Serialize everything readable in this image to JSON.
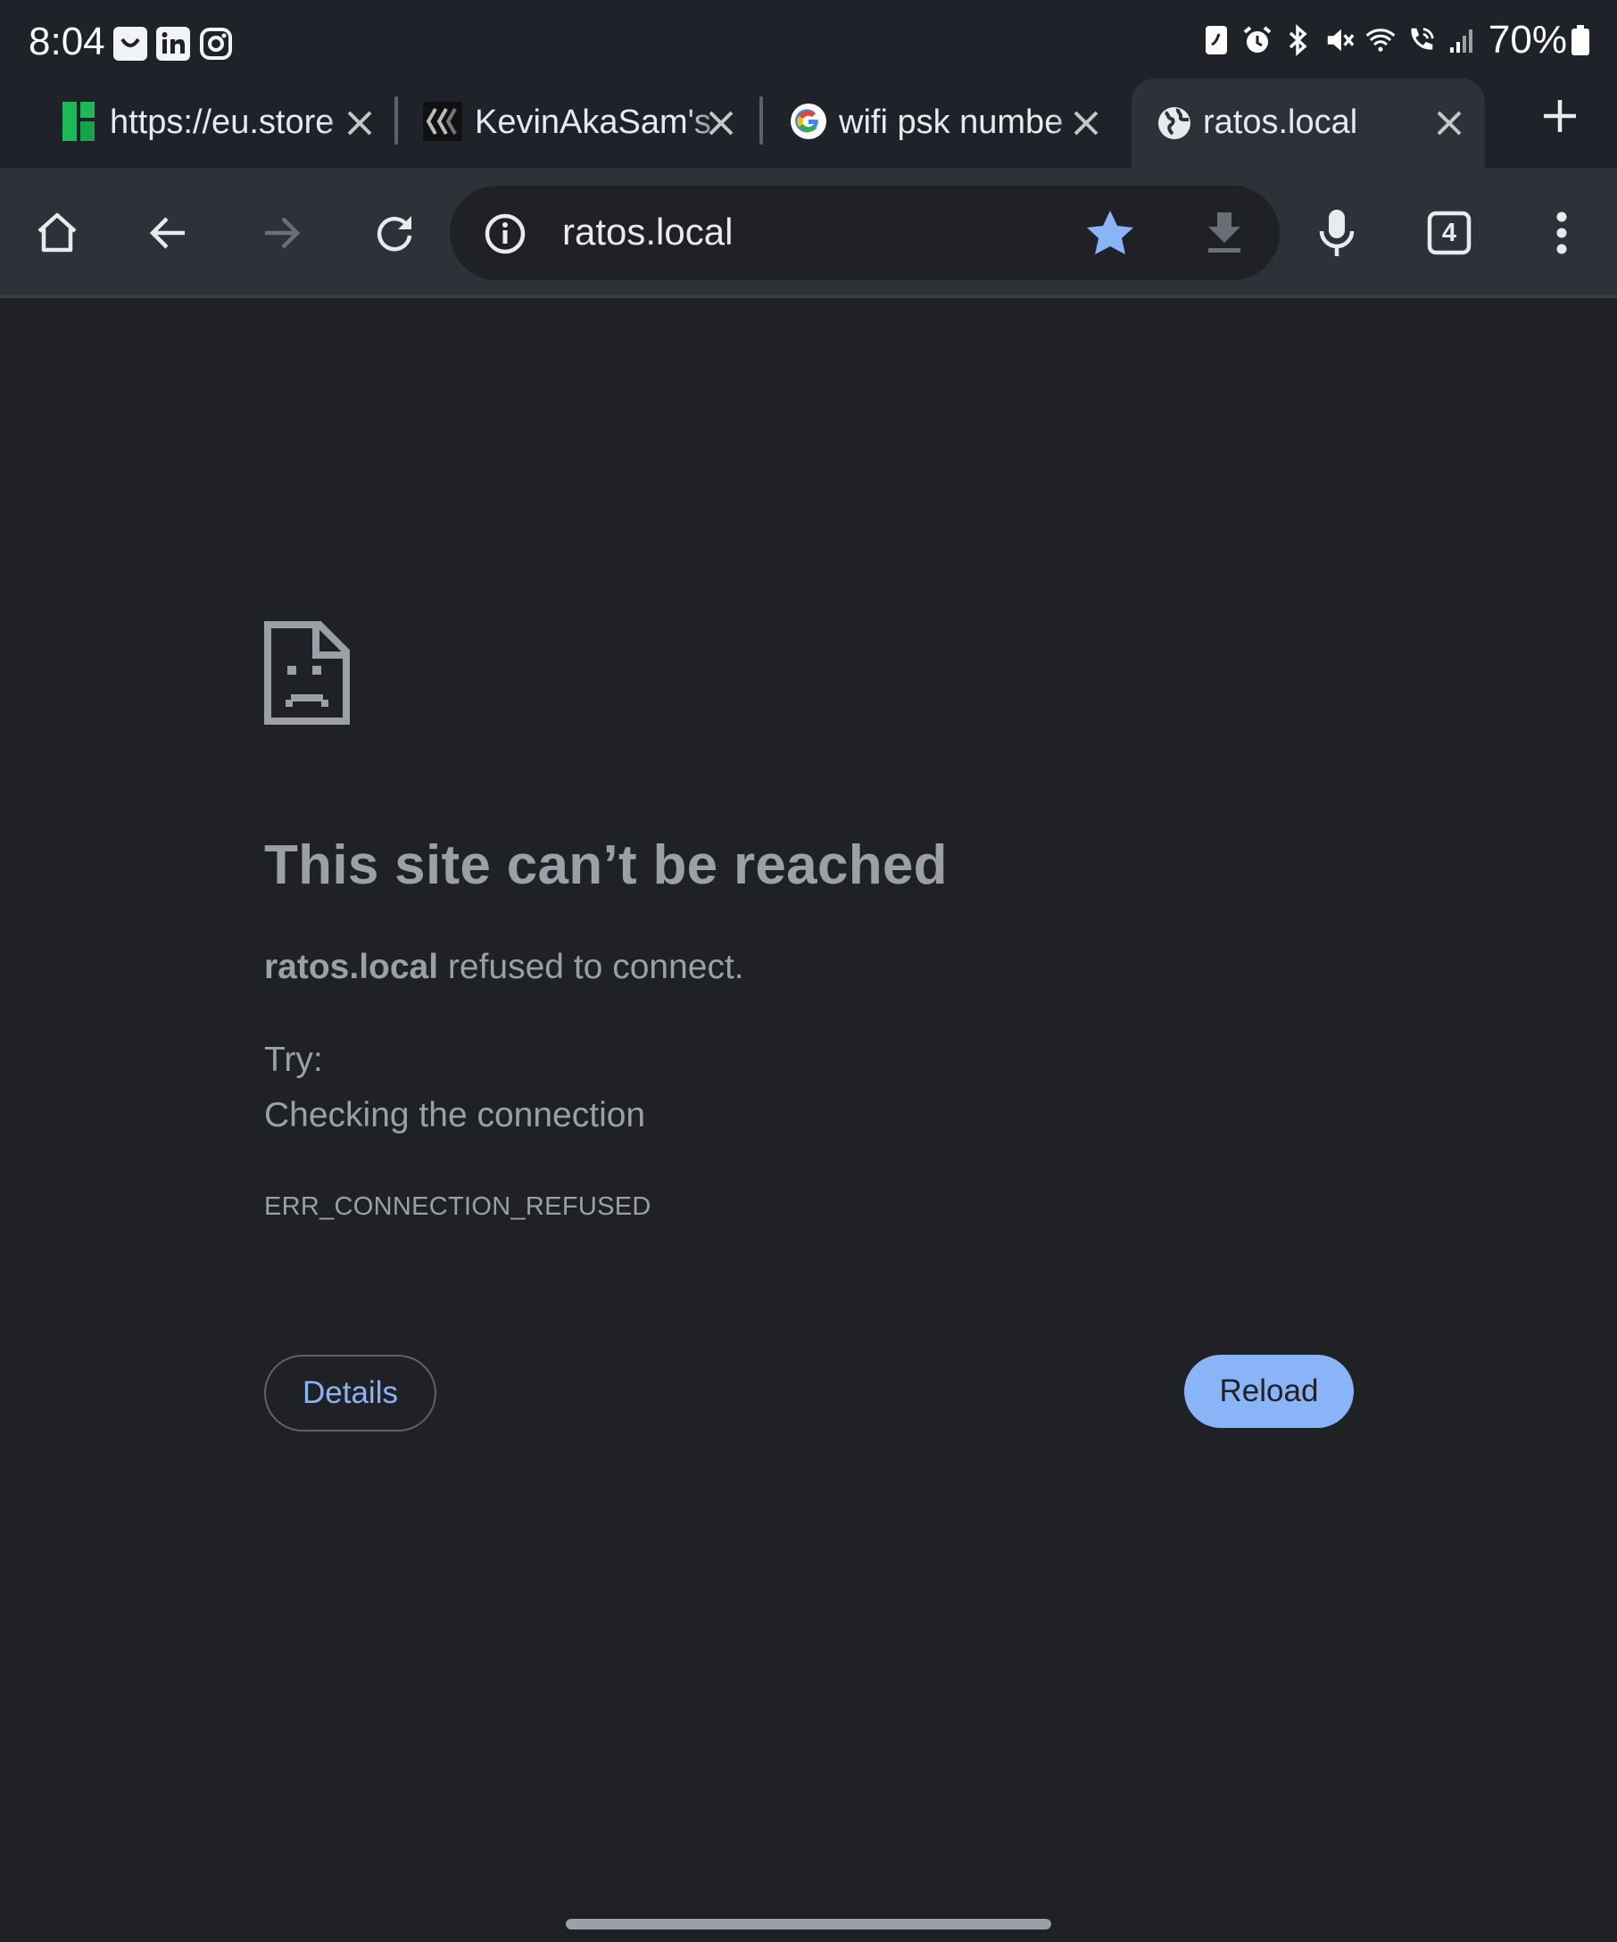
{
  "status_bar": {
    "time": "8:04",
    "battery": "70%",
    "notification_icons": [
      "smile-icon",
      "linkedin-icon",
      "instagram-icon"
    ],
    "system_icons": [
      "nfc-icon",
      "alarm-icon",
      "bluetooth-icon",
      "mute-icon",
      "wifi-icon",
      "wifi-calling-icon",
      "signal-icon",
      "battery-icon"
    ]
  },
  "tabs": [
    {
      "label": "https://eu.store",
      "favicon": "store-favicon-icon",
      "active": false
    },
    {
      "label": "KevinAkaSam's",
      "favicon": "k-favicon-icon",
      "active": false
    },
    {
      "label": "wifi psk numbe",
      "favicon": "google-favicon-icon",
      "active": false
    },
    {
      "label": "ratos.local",
      "favicon": "globe-icon",
      "active": true
    }
  ],
  "toolbar": {
    "url": "ratos.local",
    "tab_count": "4",
    "icons": [
      "home-icon",
      "back-icon",
      "forward-icon",
      "reload-icon",
      "info-icon",
      "star-icon",
      "download-icon",
      "mic-icon",
      "tab-switcher-icon",
      "more-icon"
    ]
  },
  "error": {
    "title": "This site can’t be reached",
    "host": "ratos.local",
    "description": " refused to connect.",
    "try_label": "Try:",
    "suggestion": "Checking the connection",
    "code": "ERR_CONNECTION_REFUSED",
    "details_label": "Details",
    "reload_label": "Reload"
  },
  "colors": {
    "background": "#202124",
    "toolbar": "#2e3138",
    "accent": "#8ab4f8",
    "text_muted": "#9aa0a6"
  }
}
